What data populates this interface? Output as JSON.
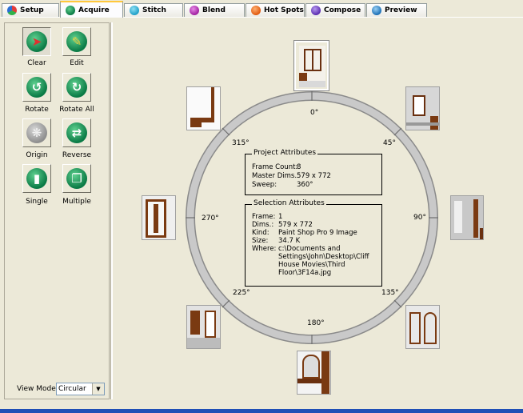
{
  "tabs": [
    {
      "label": "Setup",
      "icon": "setup-icon",
      "color": "#2a6fd6"
    },
    {
      "label": "Acquire",
      "icon": "acquire-icon",
      "color": "#0a7a45"
    },
    {
      "label": "Stitch",
      "icon": "stitch-icon",
      "color": "#1e9fc7"
    },
    {
      "label": "Blend",
      "icon": "blend-icon",
      "color": "#a020a0"
    },
    {
      "label": "Hot Spots",
      "icon": "hotspots-icon",
      "color": "#e05a10"
    },
    {
      "label": "Compose",
      "icon": "compose-icon",
      "color": "#5b2db0"
    },
    {
      "label": "Preview",
      "icon": "preview-icon",
      "color": "#1b6fb5"
    }
  ],
  "active_tab": "Acquire",
  "tools": [
    {
      "label": "Clear",
      "icon": "clear-icon",
      "enabled": true,
      "pressed": true
    },
    {
      "label": "Edit",
      "icon": "edit-icon",
      "enabled": true,
      "pressed": false
    },
    {
      "label": "Rotate",
      "icon": "rotate-icon",
      "enabled": true,
      "pressed": false
    },
    {
      "label": "Rotate All",
      "icon": "rotate-all-icon",
      "enabled": true,
      "pressed": false
    },
    {
      "label": "Origin",
      "icon": "origin-icon",
      "enabled": false,
      "pressed": false
    },
    {
      "label": "Reverse",
      "icon": "reverse-icon",
      "enabled": true,
      "pressed": false
    },
    {
      "label": "Single",
      "icon": "single-icon",
      "enabled": true,
      "pressed": false
    },
    {
      "label": "Multiple",
      "icon": "multiple-icon",
      "enabled": true,
      "pressed": false
    }
  ],
  "view_mode": {
    "label": "View Mode:",
    "value": "Circular"
  },
  "angles": {
    "a0": "0°",
    "a45": "45°",
    "a90": "90°",
    "a135": "135°",
    "a180": "180°",
    "a225": "225°",
    "a270": "270°",
    "a315": "315°"
  },
  "project": {
    "title": "Project Attributes",
    "frame_count_label": "Frame Count:",
    "frame_count": "8",
    "master_dims_label": "Master Dims.:",
    "master_dims": "579 x 772",
    "sweep_label": "Sweep:",
    "sweep": "360°"
  },
  "selection": {
    "title": "Selection Attributes",
    "frame_label": "Frame:",
    "frame": "1",
    "dims_label": "Dims.:",
    "dims": "579 x 772",
    "kind_label": "Kind:",
    "kind": "Paint Shop Pro 9 Image",
    "size_label": "Size:",
    "size": "34.7 K",
    "where_label": "Where:",
    "where_lines": [
      "c:\\Documents and",
      "Settings\\John\\Desktop\\Cliff",
      "House Movies\\Third",
      "Floor\\3F14a.jpg"
    ]
  },
  "colors": {
    "accent_tab": "#ffc83c",
    "wood": "#7a3a12",
    "ring": "#b8b8b8",
    "select_blue": "#1f4fb6"
  }
}
